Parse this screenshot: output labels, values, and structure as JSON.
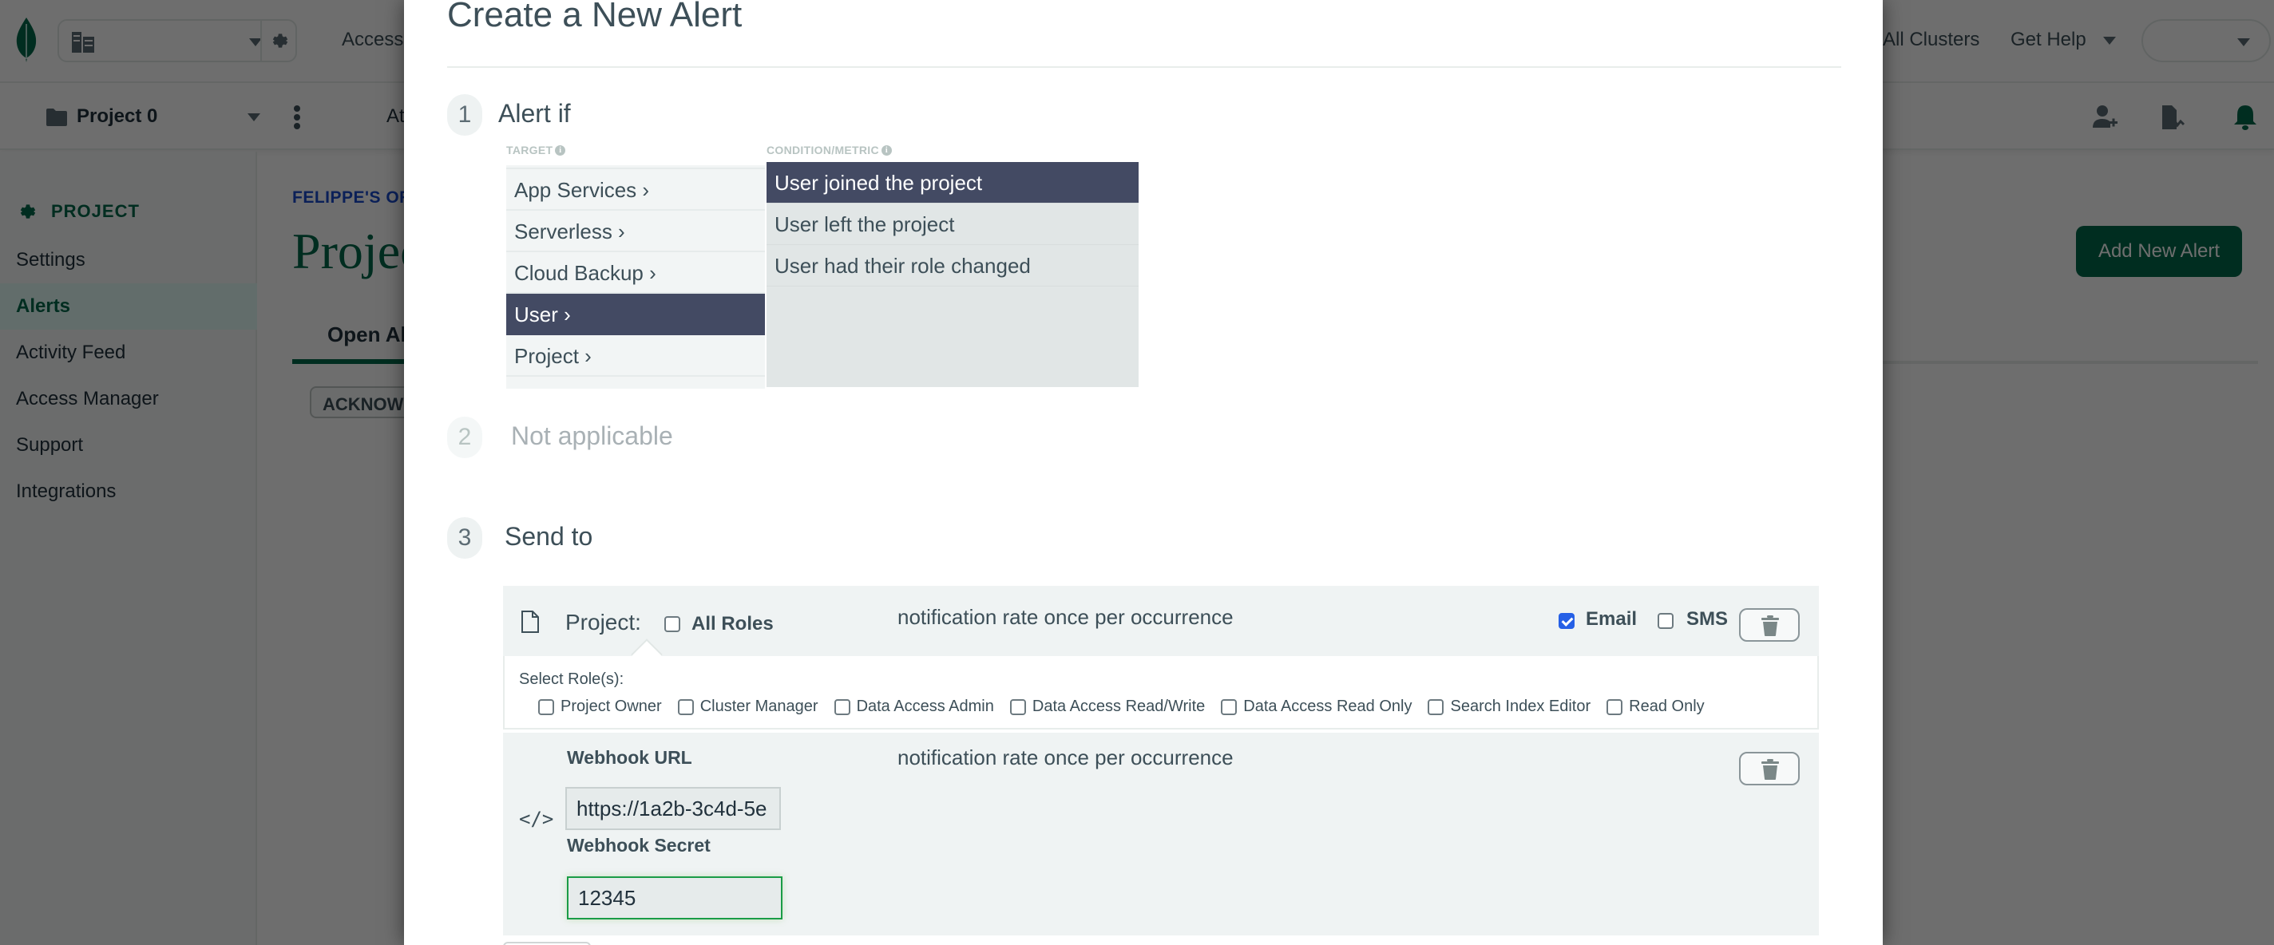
{
  "topbar": {
    "access_label": "Access",
    "all_clusters_label": "All Clusters",
    "get_help_label": "Get Help"
  },
  "subbar": {
    "project_name": "Project 0",
    "truncated_link": "At"
  },
  "sidebar": {
    "section_title": "PROJECT",
    "items": [
      {
        "label": "Settings"
      },
      {
        "label": "Alerts",
        "active": true
      },
      {
        "label": "Activity Feed"
      },
      {
        "label": "Access Manager"
      },
      {
        "label": "Support"
      },
      {
        "label": "Integrations"
      }
    ]
  },
  "main": {
    "breadcrumb": "FELIPPE'S ORG",
    "title": "Project",
    "tab_open": "Open Alerts",
    "acknowledge_label": "ACKNOWLEDGE",
    "add_alert_label": "Add New Alert"
  },
  "modal": {
    "title": "Create a New Alert",
    "steps": [
      {
        "num": "1",
        "label": "Alert if"
      },
      {
        "num": "2",
        "label": "Not applicable"
      },
      {
        "num": "3",
        "label": "Send to"
      }
    ],
    "target_header": "TARGET",
    "condition_header": "CONDITION/METRIC",
    "targets": [
      {
        "label": "App Services ›"
      },
      {
        "label": "Serverless ›"
      },
      {
        "label": "Cloud Backup ›"
      },
      {
        "label": "User ›",
        "selected": true
      },
      {
        "label": "Project ›"
      }
    ],
    "conditions": [
      {
        "label": "User joined the project",
        "selected": true
      },
      {
        "label": "User left the project"
      },
      {
        "label": "User had their role changed"
      }
    ],
    "notification_project": {
      "label": "Project:",
      "all_roles_label": "All Roles",
      "all_roles_checked": false,
      "rate_text": "notification rate once per occurrence",
      "email_label": "Email",
      "email_checked": true,
      "sms_label": "SMS",
      "sms_checked": false,
      "select_roles_label": "Select Role(s):",
      "roles": [
        {
          "label": "Project Owner",
          "checked": false
        },
        {
          "label": "Cluster Manager",
          "checked": false
        },
        {
          "label": "Data Access Admin",
          "checked": false
        },
        {
          "label": "Data Access Read/Write",
          "checked": false
        },
        {
          "label": "Data Access Read Only",
          "checked": false
        },
        {
          "label": "Search Index Editor",
          "checked": false
        },
        {
          "label": "Read Only",
          "checked": false
        }
      ]
    },
    "notification_webhook": {
      "url_label": "Webhook URL",
      "url_value": "https://1a2b-3c4d-5e",
      "secret_label": "Webhook Secret",
      "secret_value": "12345",
      "rate_text": "notification rate once per occurrence"
    }
  },
  "colors": {
    "brand_green": "#00684a",
    "selected_row": "#434a63",
    "checkbox_blue": "#2660e6",
    "focus_green": "#1a9c46"
  }
}
